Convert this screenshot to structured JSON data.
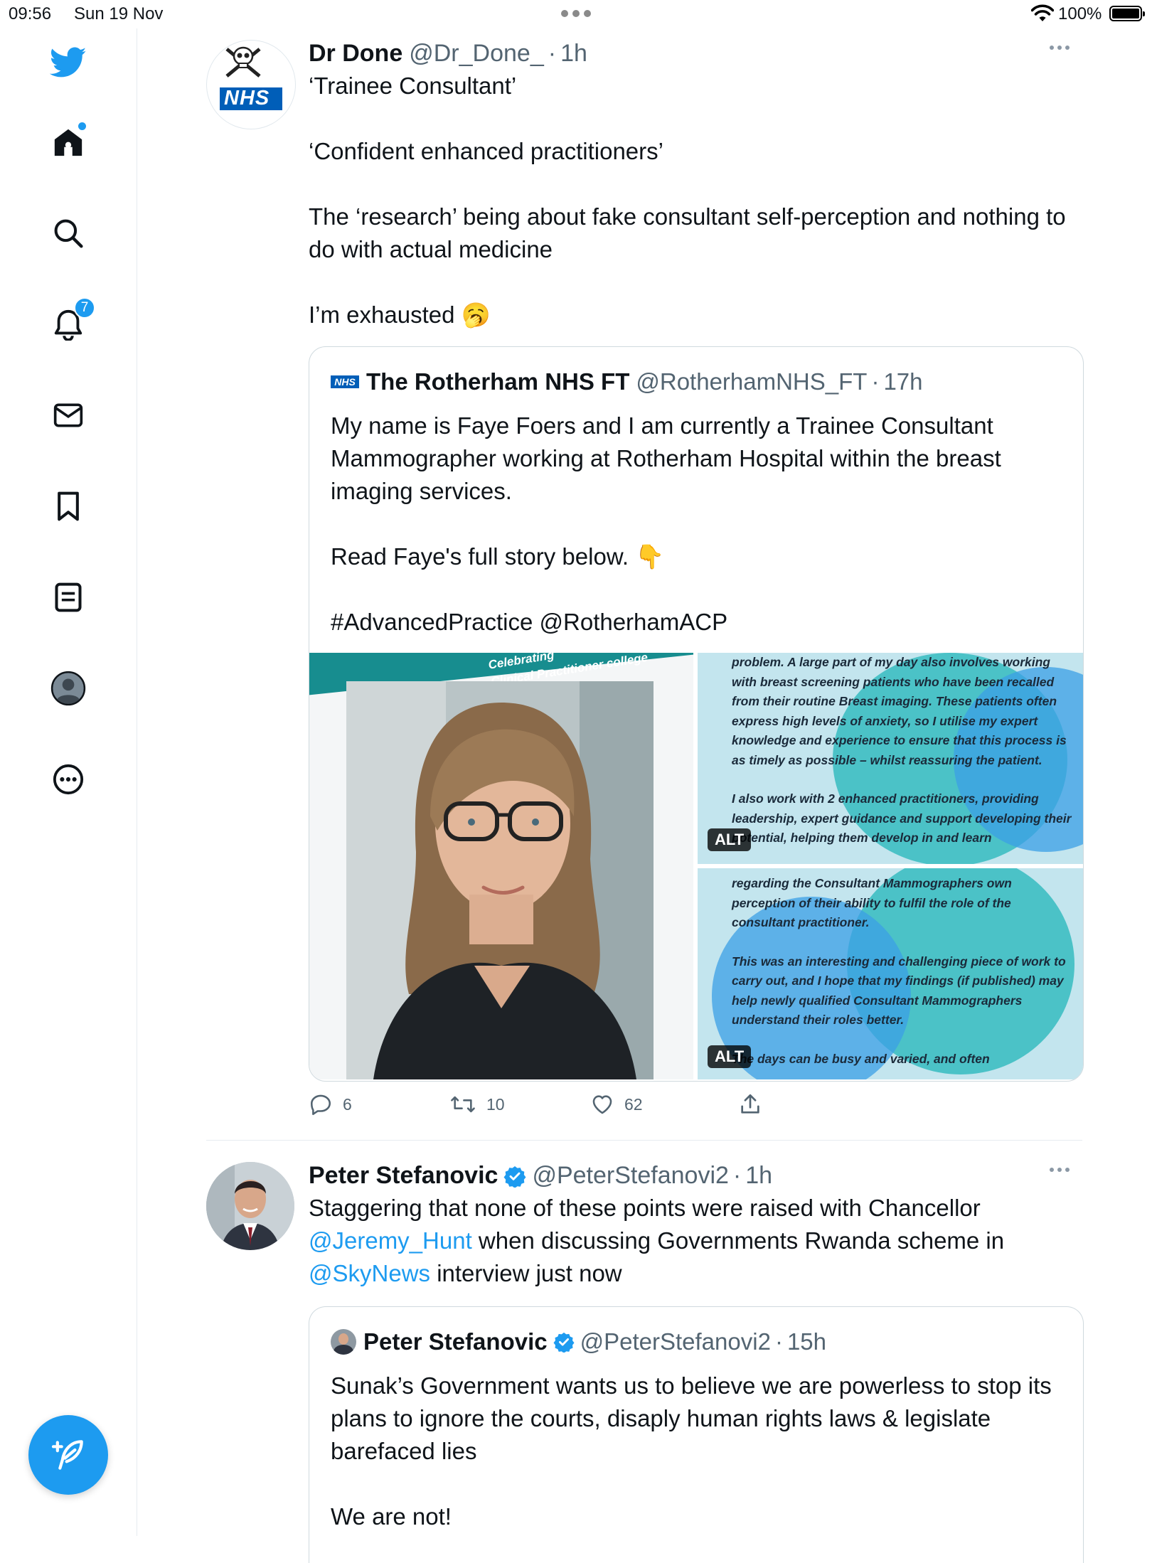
{
  "status_bar": {
    "time": "09:56",
    "date": "Sun 19 Nov",
    "battery": "100%"
  },
  "sidebar": {
    "items": [
      {
        "name": "twitter-logo"
      },
      {
        "name": "home",
        "dot": true
      },
      {
        "name": "explore"
      },
      {
        "name": "notifications",
        "count": "7"
      },
      {
        "name": "messages"
      },
      {
        "name": "bookmarks"
      },
      {
        "name": "lists"
      },
      {
        "name": "profile"
      },
      {
        "name": "more"
      }
    ],
    "compose_label": "+"
  },
  "tweets": [
    {
      "name": "Dr Done",
      "handle": "@Dr_Done_",
      "time": "1h",
      "avatar_text": "NHS",
      "body": [
        "‘Trainee Consultant’",
        "‘Confident enhanced practitioners’",
        "The ‘research’ being about fake consultant self-perception and nothing to do with actual medicine",
        "I’m exhausted 🥱"
      ],
      "quote": {
        "name": "The Rotherham NHS FT",
        "handle": "@RotherhamNHS_FT",
        "time": "17h",
        "avatar_text": "NHS",
        "body": [
          "My name is Faye Foers and I am currently a Trainee Consultant Mammographer working at Rotherham Hospital within the breast imaging services.",
          "Read Faye's full story below. 👇",
          "#AdvancedPractice @RotherhamACP"
        ],
        "media": {
          "banner_text": "Celebrating\nClinical Practitioner college",
          "image1_text": [
            "problem. A large part of my day also involves working with breast screening patients who have been recalled from their routine Breast imaging. These patients often express high levels of anxiety, so I utilise my expert knowledge and experience to ensure that this process is as timely as possible – whilst reassuring the patient.",
            "I also work with 2 enhanced practitioners, providing leadership, expert guidance and support developing their potential, helping them develop in and learn"
          ],
          "image2_text": [
            "regarding the Consultant Mammographers own perception of their ability to fulfil the role of the consultant practitioner.",
            "This was an interesting and challenging piece of work to carry out, and I hope that my findings (if published) may help newly qualified Consultant Mammographers understand their roles better.",
            "The days can be busy and varied, and often"
          ],
          "alt_label": "ALT"
        }
      },
      "stats": {
        "replies": "6",
        "retweets": "10",
        "likes": "62"
      }
    },
    {
      "name": "Peter Stefanovic",
      "handle": "@PeterStefanovi2",
      "time": "1h",
      "body_parts": [
        {
          "text": "Staggering that none of these points were raised with Chancellor ",
          "mention": false
        },
        {
          "text": "@Jeremy_Hunt",
          "mention": true
        },
        {
          "text": " when discussing Governments Rwanda scheme in ",
          "mention": false
        },
        {
          "text": "@SkyNews",
          "mention": true
        },
        {
          "text": " interview just now",
          "mention": false
        }
      ],
      "quote": {
        "name": "Peter Stefanovic",
        "handle": "@PeterStefanovi2",
        "time": "15h",
        "body": [
          "Sunak’s Government wants us to believe we are powerless to stop its plans to ignore the courts, disaply human rights laws & legislate barefaced lies",
          "We are not!"
        ]
      }
    }
  ],
  "colors": {
    "accent": "#1d9bf0",
    "text": "#0f1419",
    "muted": "#536471",
    "border": "#cfd9de"
  }
}
